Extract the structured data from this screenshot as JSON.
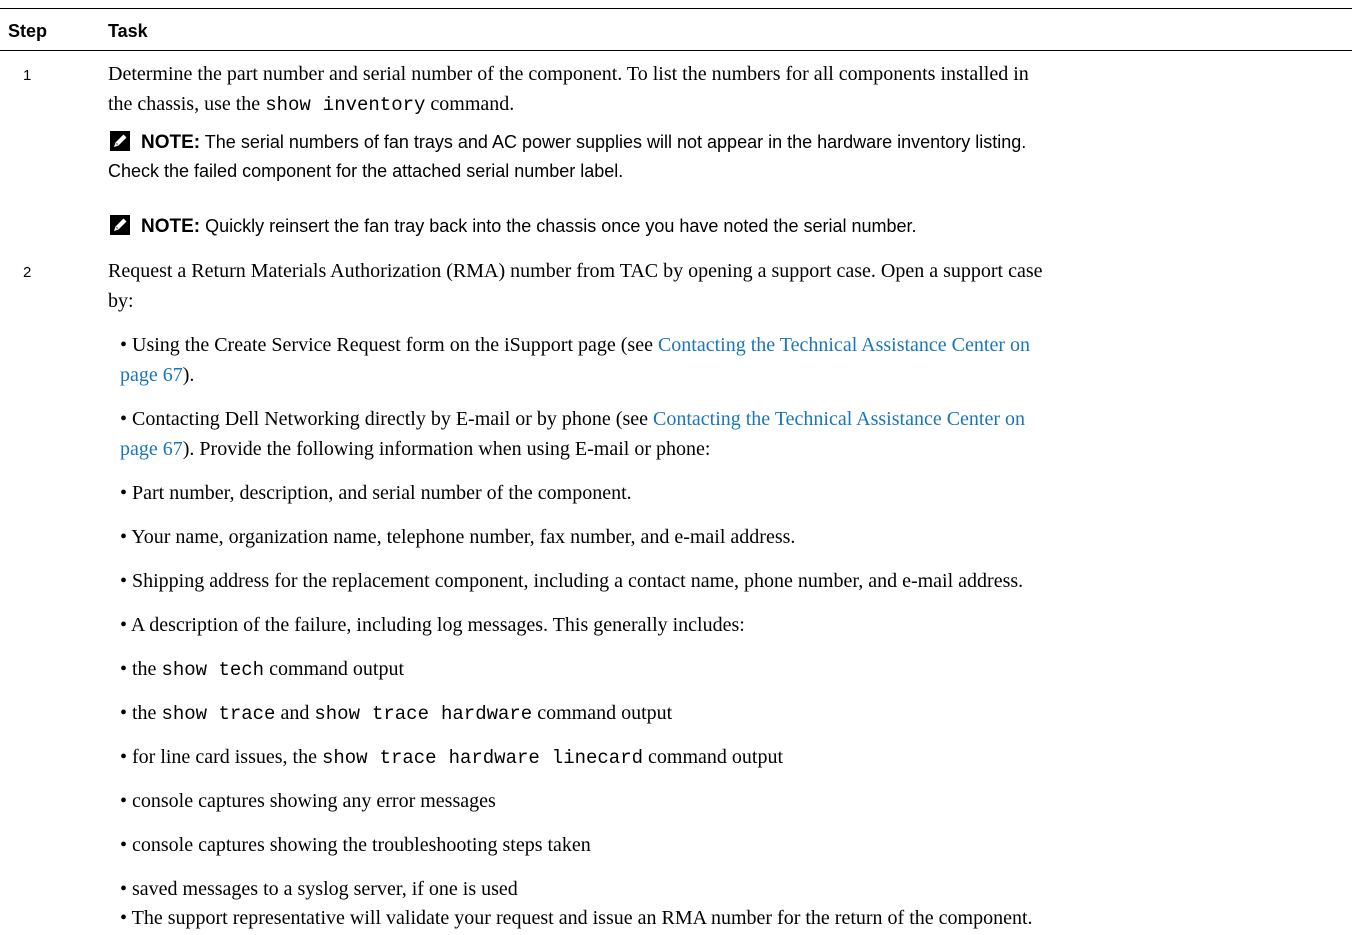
{
  "table": {
    "headers": {
      "step": "Step",
      "task": "Task"
    }
  },
  "step1": {
    "num": "1",
    "line1": "Determine the part number and serial number of the component. To list the numbers for all components installed in",
    "line2_pre": "the chassis, use the",
    "cmd_a": "show",
    "cmd_b": "inventory",
    "line2_post": "command.",
    "note_label": "NOTE:",
    "note1_line1": "The serial numbers of fan trays and AC power supplies will not appear in the hardware inventory listing.",
    "note1_line2": "Check the failed component for the attached serial number label.",
    "note2_text": "Quickly reinsert the fan tray back into the chassis once you have noted the serial number."
  },
  "step2": {
    "num": "2",
    "line1": "Request a Return Materials Authorization (RMA) number from TAC by opening a support case. Open a support case",
    "line2": "by:",
    "b1_pre": "• Using the Create Service Request form on the iSupport page (see ",
    "b1_link1": "Contacting the Technical Assistance Center on",
    "b1_link2": "page 67",
    "b1_post": ").",
    "b2_pre": "• Contacting Dell Networking directly by E-mail or by phone (see ",
    "b2_link1": "Contacting the Technical Assistance Center on",
    "b2_link2": "page 67",
    "b2_post": "). Provide the following information when using E-mail or phone:",
    "b3": "• Part number, description, and serial number of the component.",
    "b4": "• Your name, organization name, telephone number, fax number, and e-mail address.",
    "b5": "• Shipping address for the replacement component, including a contact name, phone number, and e-mail address.",
    "b6": "• A description of the failure, including log messages. This generally includes:",
    "b7_pre": "• the",
    "b7_cmd": "show tech",
    "b7_post": "command output",
    "b8_pre": "• the",
    "b8_cmd1": "show trace",
    "b8_mid": "and",
    "b8_cmd2a": "show",
    "b8_cmd2b": "trace",
    "b8_cmd2c": "hardware",
    "b8_post": "command output",
    "b9_pre": "• for line card issues, the",
    "b9_cmd_a": "show",
    "b9_cmd_b": "trace",
    "b9_cmd_c": "hardware",
    "b9_cmd_d": "linecard",
    "b9_post": "command output",
    "b10": "• console captures showing any error messages",
    "b11": "• console captures showing the troubleshooting steps taken",
    "b12": "• saved messages to a syslog server, if one is used",
    "b13": "• The support representative will validate your request and issue an RMA number for the return of the component."
  },
  "colors": {
    "link": "#1a75bb",
    "text": "#000000"
  }
}
